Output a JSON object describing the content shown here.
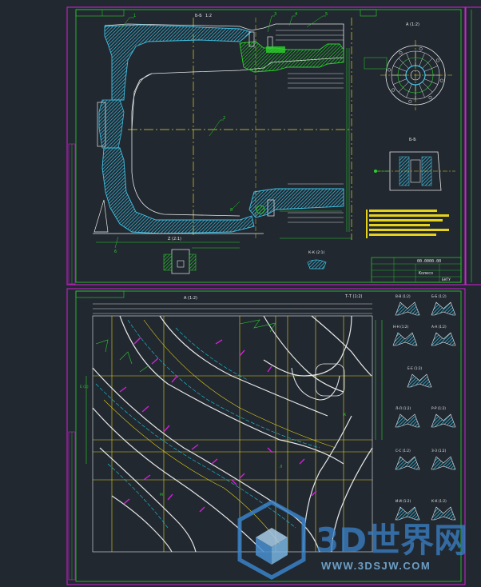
{
  "colors": {
    "background": "#212830",
    "frame": "#d21fd8",
    "border": "#2bd12b",
    "outline": "#e8e8e8",
    "centerline": "#e6d21a",
    "hatch": "#3ec3e6",
    "dimension": "#2bd12b",
    "cyan": "#21c8e0",
    "watermark": "#3a82c8"
  },
  "sheet_top": {
    "section_label": "Б-Б",
    "scale_label": "1:2",
    "view_a": "А (1:2)",
    "view_b": "Б-Б",
    "detail_label": "Z (2:1)",
    "detail_label_2": "К-К (2:1)",
    "callout": "Б",
    "title_block": {
      "name": "Колесо",
      "number": "00.0000.00",
      "org": "БНТУ"
    }
  },
  "sheet_bottom": {
    "view_main": "А (1:2)",
    "section_t": "Т-Т (1:2)",
    "sections_right": [
      "В-В (1:2)",
      "Б-Б (1:2)",
      "Н-Н (1:2)",
      "А-А (1:2)",
      "Е-Е (1:2)",
      "Л-Л (1:2)",
      "Р-Р (1:2)",
      "С-С (1:2)",
      "З-З (1:2)",
      "И-И (1:2)",
      "К-К (1:2)"
    ]
  },
  "watermark": {
    "brand": "3D世界网",
    "site": "WWW.3DSJW.COM"
  }
}
